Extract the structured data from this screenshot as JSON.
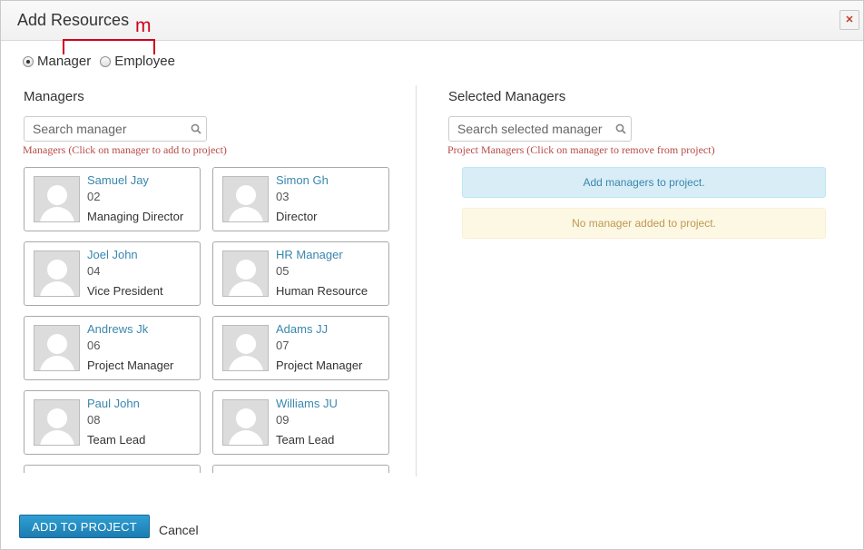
{
  "dialog": {
    "title": "Add Resources",
    "annotation": "m",
    "close_icon": "close-icon",
    "close_symbol": "✕"
  },
  "radios": [
    {
      "label": "Manager",
      "checked": true
    },
    {
      "label": "Employee",
      "checked": false
    }
  ],
  "left": {
    "title": "Managers",
    "search_placeholder": "Search manager",
    "hint": "Managers (Click on manager to add to project)",
    "managers": [
      {
        "name": "Samuel Jay",
        "code": "02",
        "role": "Managing Director"
      },
      {
        "name": "Simon Gh",
        "code": "03",
        "role": "Director"
      },
      {
        "name": "Joel John",
        "code": "04",
        "role": "Vice President"
      },
      {
        "name": "HR Manager",
        "code": "05",
        "role": "Human Resource"
      },
      {
        "name": "Andrews Jk",
        "code": "06",
        "role": "Project Manager"
      },
      {
        "name": "Adams JJ",
        "code": "07",
        "role": "Project Manager"
      },
      {
        "name": "Paul John",
        "code": "08",
        "role": "Team Lead"
      },
      {
        "name": "Williams JU",
        "code": "09",
        "role": "Team Lead"
      },
      {
        "name": "",
        "code": "",
        "role": ""
      },
      {
        "name": "",
        "code": "",
        "role": ""
      }
    ]
  },
  "right": {
    "title": "Selected Managers",
    "search_placeholder": "Search selected manager",
    "hint": "Project Managers (Click on manager to remove from project)",
    "info_message": "Add managers to project.",
    "empty_message": "No manager added to project."
  },
  "footer": {
    "add_label": "ADD TO PROJECT",
    "cancel_label": "Cancel"
  },
  "colors": {
    "link": "#3a87ad",
    "hint": "#b94a48",
    "primary_button": "#1f87bf",
    "annotation": "#d0021b"
  }
}
